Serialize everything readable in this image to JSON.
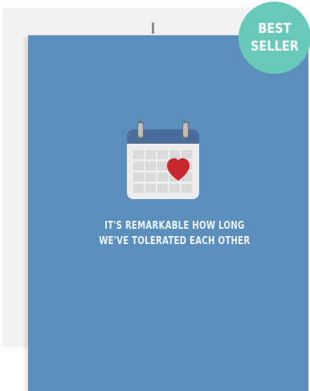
{
  "card": {
    "message_line_1": "IT'S REMARKABLE HOW LONG",
    "message_line_2": "WE'VE TOLERATED EACH OTHER",
    "illustration": "calendar-heart-icon"
  },
  "badge": {
    "line_1": "BEST",
    "line_2": "SELLER"
  },
  "colors": {
    "card_background": "#5a8fbc",
    "calendar_header": "#4a6e9a",
    "heart": "#c8262f",
    "badge": "#68c9ba"
  }
}
